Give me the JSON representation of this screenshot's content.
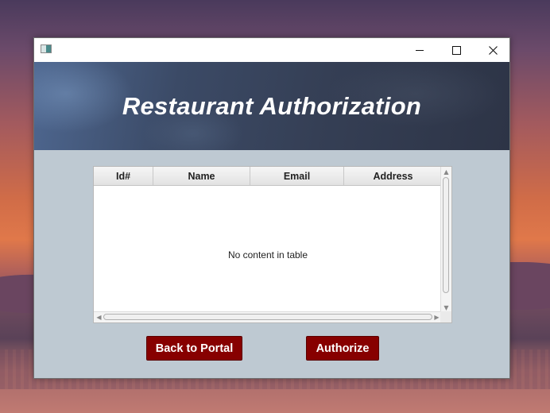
{
  "window": {
    "controls": {
      "minimize_icon": "minimize-icon",
      "maximize_icon": "maximize-icon",
      "close_icon": "close-icon"
    }
  },
  "header": {
    "title": "Restaurant Authorization"
  },
  "table": {
    "columns": [
      "Id#",
      "Name",
      "Email",
      "Address"
    ],
    "rows": [],
    "empty_message": "No content in table"
  },
  "actions": {
    "back_label": "Back to Portal",
    "authorize_label": "Authorize"
  },
  "colors": {
    "button_bg": "#870000",
    "panel_bg": "#bec9d2"
  }
}
